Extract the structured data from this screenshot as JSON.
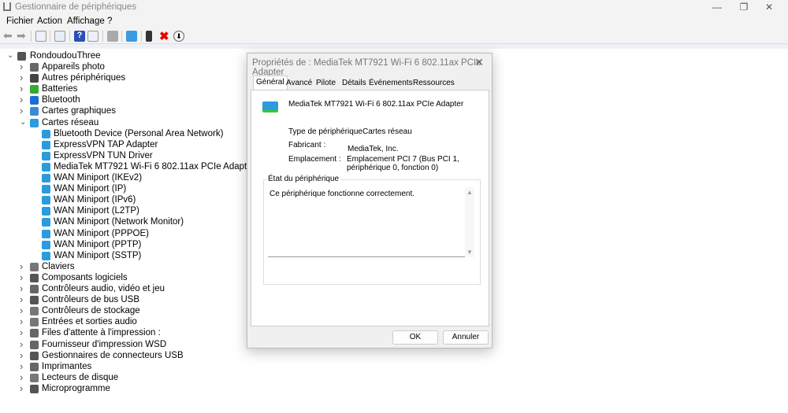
{
  "window": {
    "title": "Gestionnaire de périphériques"
  },
  "menu": [
    "Fichier",
    "Action",
    "Affichage",
    "?"
  ],
  "tree": {
    "root": "RondoudouThree",
    "items": [
      {
        "label": "Appareils photo",
        "level": 1,
        "icon": "camera-icon",
        "color": "#666"
      },
      {
        "label": "Autres périphériques",
        "level": 1,
        "icon": "unknown-device-icon",
        "color": "#444"
      },
      {
        "label": "Batteries",
        "level": 1,
        "icon": "battery-icon",
        "color": "#3a3"
      },
      {
        "label": "Bluetooth",
        "level": 1,
        "icon": "bluetooth-icon",
        "color": "#1a6fd6"
      },
      {
        "label": "Cartes graphiques",
        "level": 1,
        "icon": "display-adapter-icon",
        "color": "#3a8ad6"
      },
      {
        "label": "Cartes réseau",
        "level": 1,
        "icon": "network-adapter-icon",
        "color": "#2b9be0",
        "expanded": true
      },
      {
        "label": "Bluetooth Device (Personal Area Network)",
        "level": 2,
        "icon": "network-adapter-icon",
        "color": "#2b9be0"
      },
      {
        "label": "ExpressVPN TAP Adapter",
        "level": 2,
        "icon": "network-adapter-icon",
        "color": "#2b9be0"
      },
      {
        "label": "ExpressVPN TUN Driver",
        "level": 2,
        "icon": "network-adapter-icon",
        "color": "#2b9be0"
      },
      {
        "label": "MediaTek MT7921 Wi-Fi 6 802.11ax PCIe Adapter",
        "level": 2,
        "icon": "network-adapter-icon",
        "color": "#2b9be0"
      },
      {
        "label": "WAN Miniport (IKEv2)",
        "level": 2,
        "icon": "network-adapter-icon",
        "color": "#2b9be0"
      },
      {
        "label": "WAN Miniport (IP)",
        "level": 2,
        "icon": "network-adapter-icon",
        "color": "#2b9be0"
      },
      {
        "label": "WAN Miniport (IPv6)",
        "level": 2,
        "icon": "network-adapter-icon",
        "color": "#2b9be0"
      },
      {
        "label": "WAN Miniport (L2TP)",
        "level": 2,
        "icon": "network-adapter-icon",
        "color": "#2b9be0"
      },
      {
        "label": "WAN Miniport (Network Monitor)",
        "level": 2,
        "icon": "network-adapter-icon",
        "color": "#2b9be0"
      },
      {
        "label": "WAN Miniport (PPPOE)",
        "level": 2,
        "icon": "network-adapter-icon",
        "color": "#2b9be0"
      },
      {
        "label": "WAN Miniport (PPTP)",
        "level": 2,
        "icon": "network-adapter-icon",
        "color": "#2b9be0"
      },
      {
        "label": "WAN Miniport (SSTP)",
        "level": 2,
        "icon": "network-adapter-icon",
        "color": "#2b9be0"
      },
      {
        "label": "Claviers",
        "level": 1,
        "icon": "keyboard-icon",
        "color": "#777"
      },
      {
        "label": "Composants logiciels",
        "level": 1,
        "icon": "software-component-icon",
        "color": "#555"
      },
      {
        "label": "Contrôleurs audio, vidéo et jeu",
        "level": 1,
        "icon": "audio-icon",
        "color": "#666"
      },
      {
        "label": "Contrôleurs de bus USB",
        "level": 1,
        "icon": "usb-icon",
        "color": "#555"
      },
      {
        "label": "Contrôleurs de stockage",
        "level": 1,
        "icon": "storage-icon",
        "color": "#777"
      },
      {
        "label": "Entrées et sorties audio",
        "level": 1,
        "icon": "speaker-icon",
        "color": "#777"
      },
      {
        "label": "Files d'attente à l'impression :",
        "level": 1,
        "icon": "printer-icon",
        "color": "#666"
      },
      {
        "label": "Fournisseur d'impression WSD",
        "level": 1,
        "icon": "printer-icon",
        "color": "#666"
      },
      {
        "label": "Gestionnaires de connecteurs USB",
        "level": 1,
        "icon": "usb-connector-icon",
        "color": "#555"
      },
      {
        "label": "Imprimantes",
        "level": 1,
        "icon": "printer-icon",
        "color": "#666"
      },
      {
        "label": "Lecteurs de disque",
        "level": 1,
        "icon": "disk-drive-icon",
        "color": "#777"
      },
      {
        "label": "Microprogramme",
        "level": 1,
        "icon": "firmware-icon",
        "color": "#555"
      }
    ]
  },
  "dialog": {
    "title": "Propriétés de : MediaTek MT7921 Wi-Fi 6 802.11ax PCIe Adapter",
    "tabs": [
      "Général",
      "Avancé",
      "Pilote",
      "Détails",
      "Événements",
      "Ressources"
    ],
    "device_name": "MediaTek MT7921 Wi-Fi 6 802.11ax PCIe Adapter",
    "type_label": "Type de périphérique",
    "type_value": "Cartes réseau",
    "manufacturer_label": "Fabricant :",
    "manufacturer_value": "MediaTek, Inc.",
    "location_label": "Emplacement :",
    "location_value": "Emplacement PCI 7 (Bus PCI 1, périphérique 0, fonction 0)",
    "status_group": "État du périphérique",
    "status_text": "Ce périphérique fonctionne correctement.",
    "ok": "OK",
    "cancel": "Annuler"
  }
}
